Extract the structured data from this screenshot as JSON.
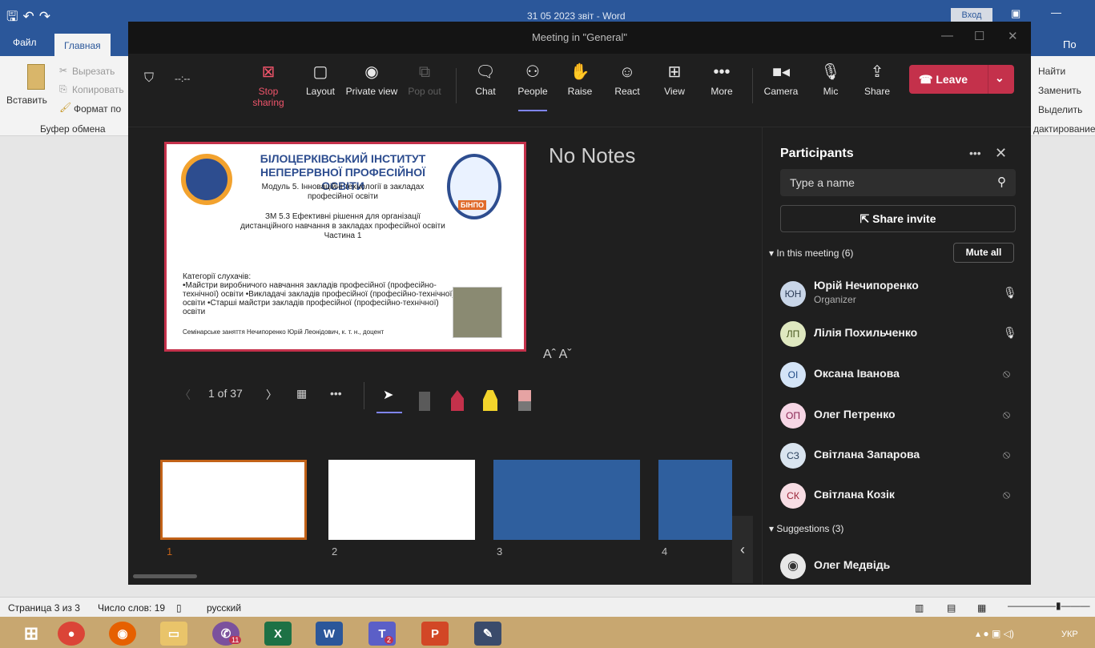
{
  "word": {
    "doc_title": "31 05 2023 звіт  -  Word",
    "signin": "Вход",
    "tabs": [
      "Файл",
      "Главная"
    ],
    "ribbon": {
      "paste": "Вставить",
      "cut": "Вырезать",
      "copy": "Копировать",
      "format_painter": "Формат по",
      "clipboard_group": "Буфер обмена",
      "find": "Найти",
      "replace": "Заменить",
      "select": "Выделить",
      "editing_group": "дактирование",
      "account": "По"
    },
    "status": {
      "page": "Страница 3 из 3",
      "words": "Число слов: 19",
      "language": "русский"
    }
  },
  "taskbar": {
    "viber_badge": "11",
    "teams_badge": "2",
    "lang": "УКР"
  },
  "teams": {
    "window_title": "Meeting in \"General\"",
    "timer": "--:--",
    "toolbar": [
      {
        "icon": "stop-share-icon",
        "label": "Stop sharing"
      },
      {
        "icon": "layout-icon",
        "label": "Layout"
      },
      {
        "icon": "eye-icon",
        "label": "Private view"
      },
      {
        "icon": "pop-out-icon",
        "label": "Pop out"
      },
      {
        "icon": "chat-icon",
        "label": "Chat"
      },
      {
        "icon": "people-icon",
        "label": "People"
      },
      {
        "icon": "hand-icon",
        "label": "Raise"
      },
      {
        "icon": "smile-icon",
        "label": "React"
      },
      {
        "icon": "grid-icon",
        "label": "View"
      },
      {
        "icon": "more-icon",
        "label": "More"
      },
      {
        "icon": "camera-icon",
        "label": "Camera"
      },
      {
        "icon": "mic-icon",
        "label": "Mic"
      },
      {
        "icon": "share-icon",
        "label": "Share"
      }
    ],
    "leave": "Leave",
    "slide": {
      "institute": "БІЛОЦЕРКІВСЬКИЙ ІНСТИТУТ НЕПЕРЕРВНОЇ ПРОФЕСІЙНОЇ ОСВІТИ",
      "module": "Модуль 5. Інноваційні технології в закладах професійної освіти",
      "topic": "ЗМ 5.3 Ефективні рішення для організації дистанційного навчання в закладах професійної освіти",
      "part": "Частина 1",
      "categories_title": "Категорії слухачів:",
      "categories": "•Майстри виробничого навчання закладів професійної (професійно-технічної) освіти •Викладачі закладів професійної (професійно-технічної) освіти •Старші майстри закладів професійної (професійно-технічної) освіти",
      "footer": "Семінарське заняття     Нечипоренко Юрій Леонідович, к. т. н., доцент",
      "logo_text": "БІНПО"
    },
    "notes": "No Notes",
    "font_controls": "Aˆ  Aˇ",
    "pager": "1 of 37",
    "thumbnails": [
      "1",
      "2",
      "3",
      "4"
    ]
  },
  "participants": {
    "title": "Participants",
    "search_placeholder": "Type a name",
    "share_invite": "Share invite",
    "in_meeting": "In this meeting (6)",
    "mute_all": "Mute all",
    "people": [
      {
        "initials": "ЮН",
        "name": "Юрій Нечипоренко",
        "role": "Organizer",
        "mic": "on",
        "color": "#c9d6e8"
      },
      {
        "initials": "ЛП",
        "name": "Лілія Похильченко",
        "role": "",
        "mic": "on",
        "color": "#dfe8c0"
      },
      {
        "initials": "ОІ",
        "name": "Оксана Іванова",
        "role": "",
        "mic": "off",
        "color": "#d4e4f7"
      },
      {
        "initials": "ОП",
        "name": "Олег Петренко",
        "role": "",
        "mic": "off",
        "color": "#f6d6e5"
      },
      {
        "initials": "СЗ",
        "name": "Світлана Запарова",
        "role": "",
        "mic": "off",
        "color": "#d9e4ef"
      },
      {
        "initials": "СК",
        "name": "Світлана Козік",
        "role": "",
        "mic": "off",
        "color": "#f7dde4"
      }
    ],
    "suggestions": "Suggestions (3)",
    "suggested": [
      {
        "name": "Олег Медвідь"
      }
    ]
  }
}
